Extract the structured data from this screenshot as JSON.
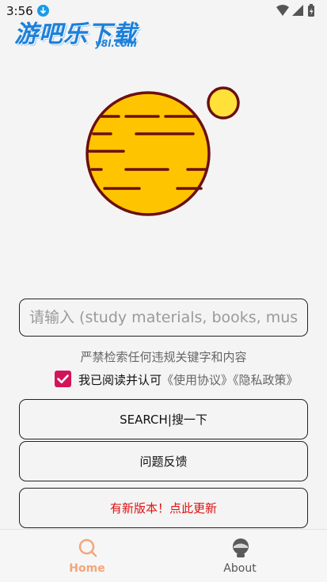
{
  "status_bar": {
    "time": "3:56",
    "icons": [
      "download-icon",
      "wifi-icon",
      "signal-icon",
      "battery-icon"
    ]
  },
  "logo": {
    "text": "游吧乐下载",
    "sub": "y8l.com"
  },
  "search": {
    "placeholder": "请输入 (study materials, books, music",
    "value": ""
  },
  "warning_text": "严禁检索任何违规关键字和内容",
  "agreement": {
    "checked": true,
    "text": "我已阅读并认可",
    "links": "《使用协议》《隐私政策》"
  },
  "buttons": {
    "search": "SEARCH|搜一下",
    "feedback": "问题反馈",
    "update": "有新版本！点此更新"
  },
  "bottom_nav": {
    "items": [
      {
        "label": "Home",
        "icon": "search-icon",
        "active": true
      },
      {
        "label": "About",
        "icon": "profile-icon",
        "active": false
      }
    ]
  },
  "colors": {
    "accent": "#f3a67a",
    "checkbox": "#d4145a",
    "update_text": "#e01010",
    "planet_fill": "#ffc400",
    "planet_stroke": "#6b0f12",
    "moon_fill": "#ffe13a",
    "logo_blue": "#1e7fd9"
  }
}
